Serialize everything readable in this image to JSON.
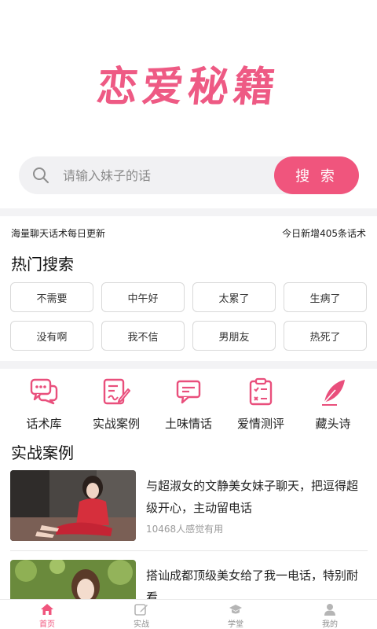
{
  "logo": {
    "text": "恋爱秘籍"
  },
  "search": {
    "placeholder": "请输入妹子的话",
    "button_label": "搜 索"
  },
  "info": {
    "left": "海量聊天话术每日更新",
    "right": "今日新增405条话术"
  },
  "hot_search": {
    "title": "热门搜索",
    "tags": [
      "不需要",
      "中午好",
      "太累了",
      "生病了",
      "没有啊",
      "我不信",
      "男朋友",
      "热死了"
    ]
  },
  "features": [
    {
      "label": "话术库",
      "icon": "chat-bubbles-icon"
    },
    {
      "label": "实战案例",
      "icon": "document-edit-icon"
    },
    {
      "label": "土味情话",
      "icon": "message-icon"
    },
    {
      "label": "爱情测评",
      "icon": "clipboard-check-icon"
    },
    {
      "label": "藏头诗",
      "icon": "feather-icon"
    }
  ],
  "cases": {
    "title": "实战案例",
    "items": [
      {
        "title": "与超淑女的文静美女妹子聊天，把逗得超级开心，主动留电话",
        "meta": "10468人感觉有用"
      },
      {
        "title": "搭讪成都顶级美女给了我一电话，特别耐看",
        "meta": ""
      }
    ]
  },
  "tabs": [
    {
      "label": "首页",
      "icon": "home-icon",
      "active": true
    },
    {
      "label": "实战",
      "icon": "edit-icon",
      "active": false
    },
    {
      "label": "学堂",
      "icon": "graduation-cap-icon",
      "active": false
    },
    {
      "label": "我的",
      "icon": "user-icon",
      "active": false
    }
  ],
  "colors": {
    "accent": "#f0557d",
    "logo": "#ee5a84",
    "search_bg": "#f1f1f3",
    "icon_pink": "#e94f7c"
  }
}
